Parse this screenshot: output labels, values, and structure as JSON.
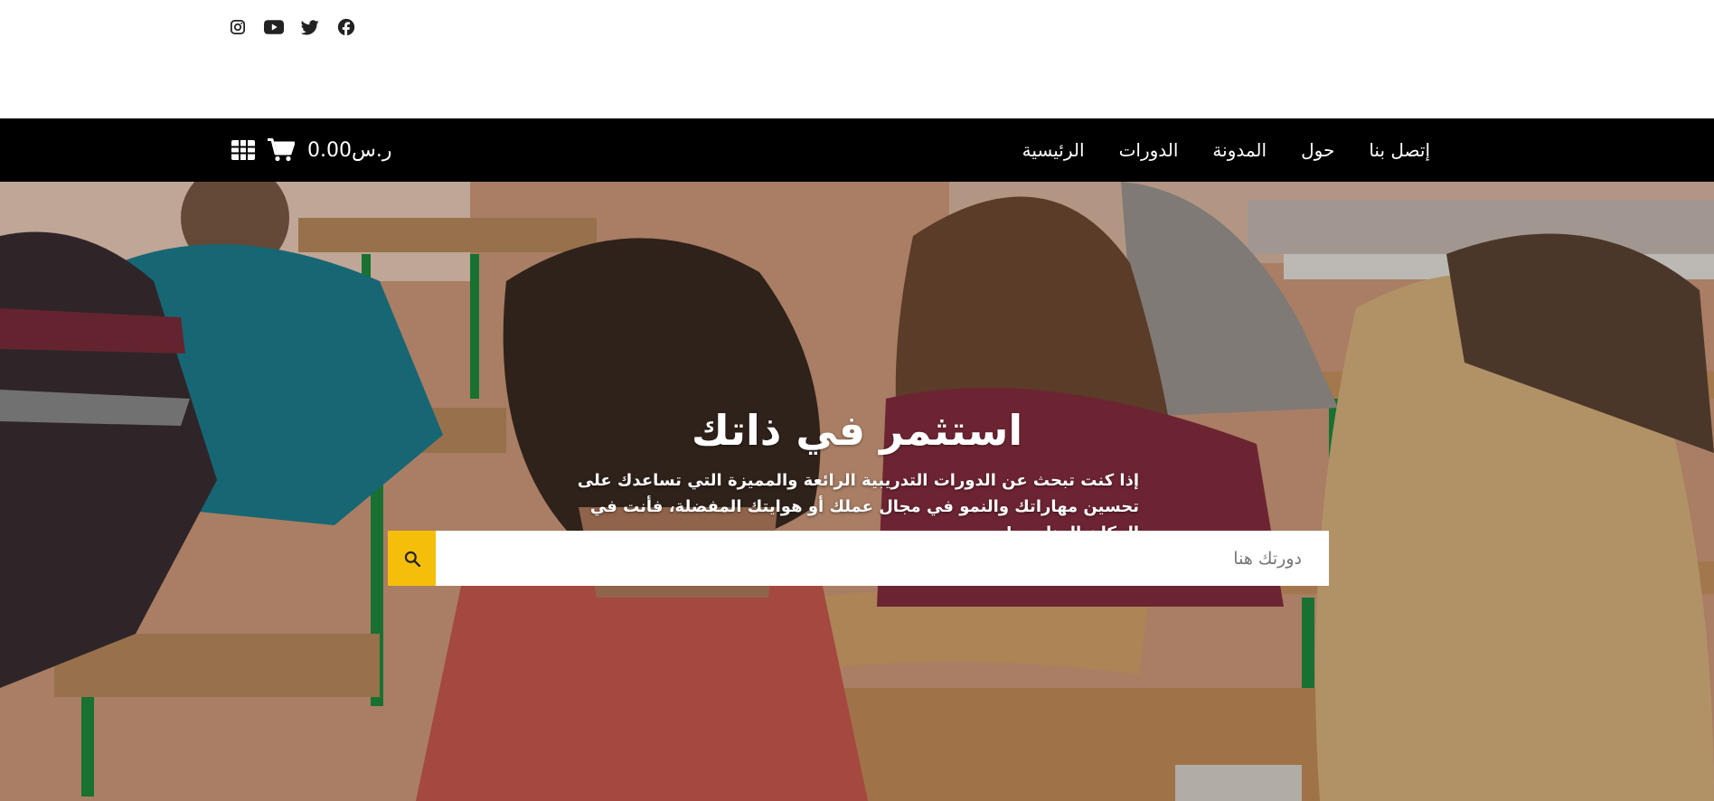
{
  "social": {
    "icons": [
      "instagram-icon",
      "youtube-icon",
      "twitter-icon",
      "facebook-icon"
    ]
  },
  "nav": {
    "items": [
      {
        "label": "الرئيسية"
      },
      {
        "label": "الدورات"
      },
      {
        "label": "المدونة"
      },
      {
        "label": "حول"
      },
      {
        "label": "إتصل بنا"
      }
    ],
    "cart_total": "ر.س0.00",
    "icons": [
      "cart-icon",
      "grid-icon"
    ]
  },
  "hero": {
    "title": "استثمر في ذاتك",
    "subtitle": "إذا كنت تبحث عن الدورات التدريبية الرائعة والمميزة التي تساعدك على تحسين مهاراتك والنمو في مجال عملك أو هوايتك المفضلة، فأنت في المكان المناسب!",
    "search_placeholder": "دورتك هنا",
    "search_icon": "search-icon"
  },
  "colors": {
    "navbar_bg": "#000000",
    "accent": "#f5be0a",
    "text_light": "#ffffff"
  }
}
